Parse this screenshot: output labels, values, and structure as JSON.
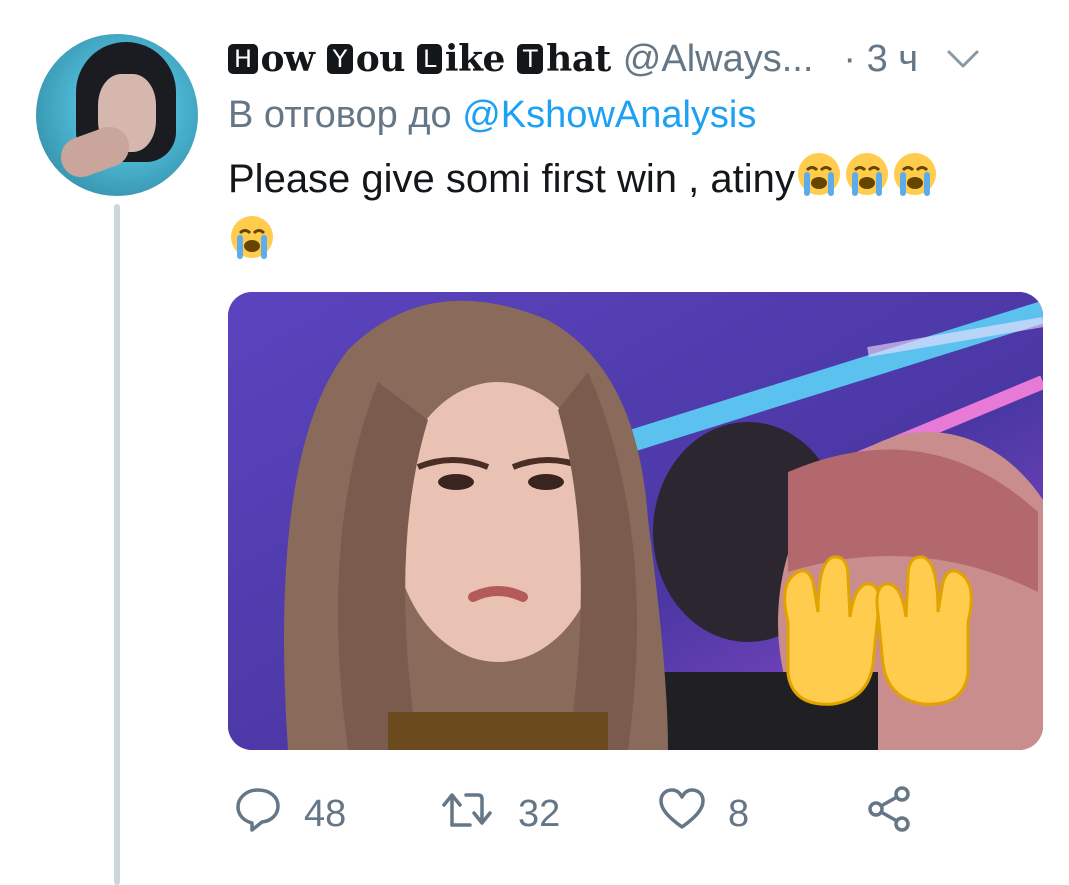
{
  "author": {
    "display_name_parts": [
      {
        "boxed": "H",
        "rest": "ow"
      },
      {
        "boxed": "Y",
        "rest": "ou"
      },
      {
        "boxed": "L",
        "rest": "ike"
      },
      {
        "boxed": "T",
        "rest": "hat"
      }
    ],
    "handle": "@Always...",
    "time": "· 3 ч"
  },
  "reply_context": {
    "prefix": "В отговор до",
    "mention": "@KshowAnalysis"
  },
  "tweet": {
    "text": "Please give somi first win , atiny",
    "emoji_name": "loudly-crying-face",
    "emoji_count": 4
  },
  "media": {
    "overlay_emoji": "raised-hands-icon"
  },
  "actions": {
    "replies": "48",
    "retweets": "32",
    "likes": "8"
  },
  "colors": {
    "link": "#1da1f2",
    "secondary_text": "#657786",
    "thread_line": "#ccd6dd"
  }
}
